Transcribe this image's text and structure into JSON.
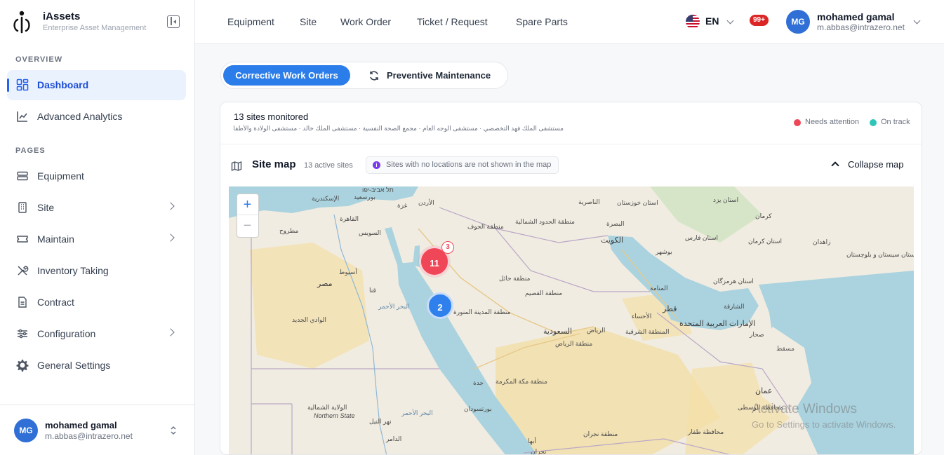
{
  "brand": {
    "name": "iAssets",
    "subtitle": "Enterprise Asset Management"
  },
  "sidebar": {
    "overview_label": "OVERVIEW",
    "pages_label": "PAGES",
    "overview_items": [
      {
        "label": "Dashboard",
        "icon": "dashboard-icon",
        "active": true
      },
      {
        "label": "Advanced Analytics",
        "icon": "chart-icon"
      }
    ],
    "page_items": [
      {
        "label": "Equipment",
        "icon": "server-icon"
      },
      {
        "label": "Site",
        "icon": "building-icon",
        "expandable": true
      },
      {
        "label": "Maintain",
        "icon": "ticket-icon",
        "expandable": true
      },
      {
        "label": "Inventory Taking",
        "icon": "tools-icon"
      },
      {
        "label": "Contract",
        "icon": "document-icon"
      },
      {
        "label": "Configuration",
        "icon": "sliders-icon",
        "expandable": true
      },
      {
        "label": "General Settings",
        "icon": "gear-icon"
      }
    ],
    "user": {
      "initials": "MG",
      "name": "mohamed gamal",
      "email": "m.abbas@intrazero.net"
    }
  },
  "topbar": {
    "nav": [
      "Equipment",
      "Site",
      "Work Order",
      "Ticket / Request",
      "Spare Parts"
    ],
    "language": "EN",
    "notifications": "99+",
    "user": {
      "initials": "MG",
      "name": "mohamed gamal",
      "email": "m.abbas@intrazero.net"
    }
  },
  "tabs": {
    "active": "Corrective Work Orders",
    "inactive": "Preventive Maintenance"
  },
  "sites": {
    "title": "13 sites monitored",
    "list": "مستشفى الملك فهد التخصصي · مستشفى الوجه العام · مجمع الصحة النفسية · مستشفى الملك خالد · مستشفى الولادة والأطفال...",
    "legend": [
      {
        "label": "Needs attention",
        "color": "#ef4757"
      },
      {
        "label": "On track",
        "color": "#2dc6b8"
      }
    ]
  },
  "map": {
    "title": "Site map",
    "subtitle": "13 active sites",
    "note": "Sites with no locations are not shown in the map",
    "collapse_label": "Collapse map",
    "zoom_in": "+",
    "zoom_out": "−",
    "clusters": [
      {
        "count": "11",
        "badge": "3",
        "color": "#ef4757"
      },
      {
        "count": "2",
        "color": "#2f80ed"
      }
    ],
    "places": {
      "alexandria": "الإسكندرية",
      "port_said": "بورسعيد",
      "cairo": "القاهرة",
      "suez": "السويس",
      "matrouh": "مطروح",
      "asyut": "أسيوط",
      "egypt": "مصر",
      "qena": "قنا",
      "new_valley": "الوادي الجديد",
      "red_sea_eg": "البحر الأحمر",
      "jordan": "الأردن",
      "gaza": "غزة",
      "tel_aviv": "תל אביב-יפו",
      "jawf": "منطقة الجوف",
      "northern_borders": "منطقة الحدود الشمالية",
      "hail": "منطقة حائل",
      "qassim": "منطقة القصيم",
      "madinah": "منطقة المدينة المنورة",
      "riyadh_city": "الرياض",
      "saudi": "السعودية",
      "riyadh_region": "منطقة الرياض",
      "eastern": "المنطقة الشرقية",
      "makkah": "منطقة مكة المكرمة",
      "jeddah": "جدة",
      "basra": "البصرة",
      "kuwait": "الكويت",
      "nasiriyah": "الناصرية",
      "khuzestan": "استان خوزستان",
      "fars": "استان فارس",
      "bushehr": "بوشهر",
      "kerman": "كرمان",
      "kerman_prov": "استان كرمان",
      "zahedan": "زاهدان",
      "sistan": "استان سيستان و بلوچستان",
      "hormozgan": "استان هرمزگان",
      "yazd": "استان يزد",
      "manama": "المنامة",
      "qatar": "قطر",
      "ahsa": "الأحساء",
      "uae": "الإمارات العربية المتحدة",
      "sharjah": "الشارقة",
      "sohar": "صحار",
      "muscat": "مسقط",
      "oman": "عمان",
      "wusta": "محافظة الوسطى",
      "dhofar": "محافظة ظفار",
      "northern_state_ar": "الولاية الشمالية",
      "northern_state_en": "Northern State",
      "nile": "نهر النيل",
      "damer": "الدامر",
      "port_sudan": "بورتسودان",
      "red_sea_sd": "البحر الأحمر",
      "abha": "أبها",
      "najran": "نجران",
      "najran_region": "منطقة نجران",
      "kuwait_label": "الكويت"
    },
    "watermark_title": "Activate Windows",
    "watermark_sub": "Go to Settings to activate Windows."
  }
}
